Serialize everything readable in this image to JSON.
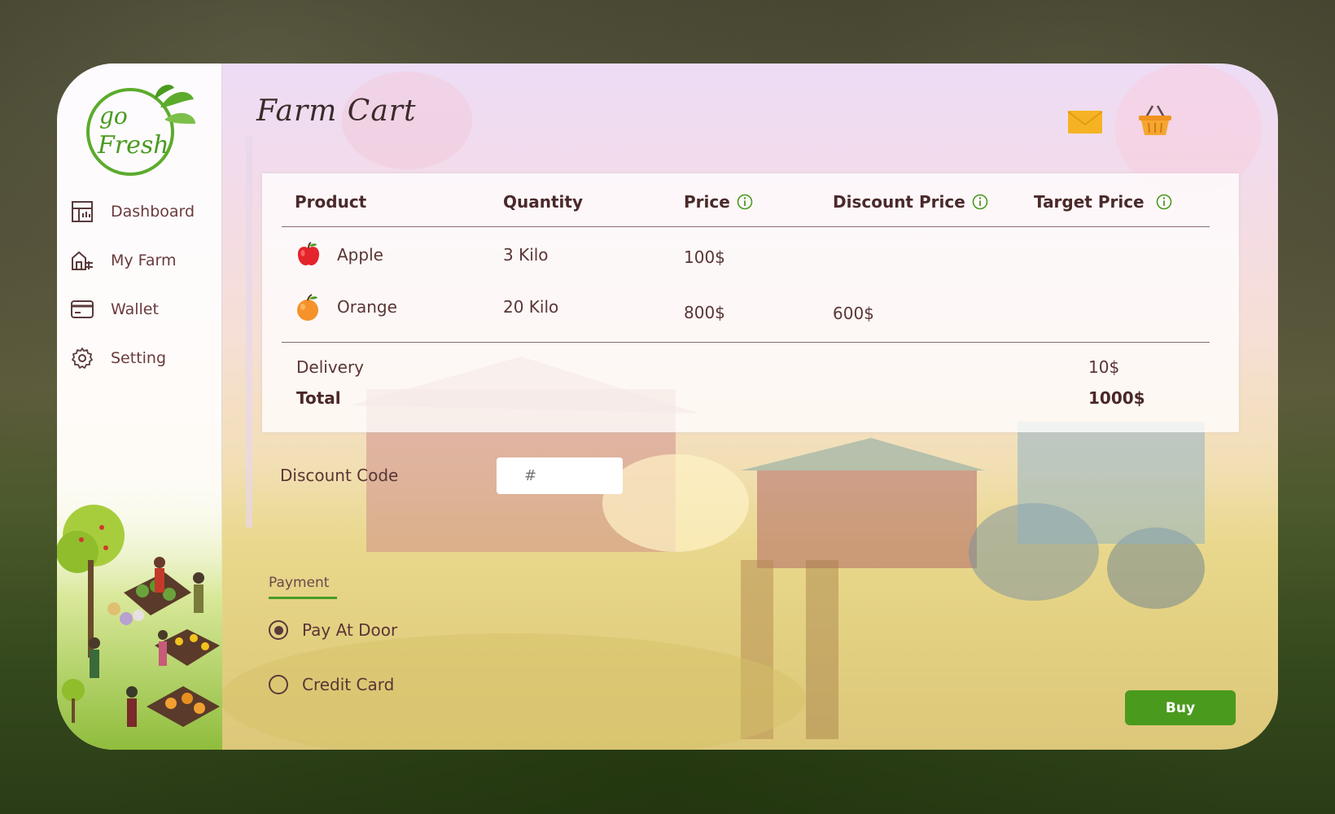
{
  "brand": {
    "logo_text_top": "go",
    "logo_text_bottom": "Fresh"
  },
  "sidebar": {
    "items": [
      {
        "label": "Dashboard",
        "icon": "dashboard-icon"
      },
      {
        "label": "My Farm",
        "icon": "farm-icon"
      },
      {
        "label": "Wallet",
        "icon": "wallet-icon"
      },
      {
        "label": "Setting",
        "icon": "gear-icon"
      }
    ]
  },
  "header": {
    "title": "Farm Cart",
    "icons": [
      "mail-icon",
      "basket-icon"
    ]
  },
  "cart": {
    "columns": [
      "Product",
      "Quantity",
      "Price",
      "Discount Price",
      "Target Price"
    ],
    "rows": [
      {
        "product": "Apple",
        "icon": "apple-icon",
        "quantity": "3 Kilo",
        "price": "100$",
        "discount_price": "",
        "target_price": ""
      },
      {
        "product": "Orange",
        "icon": "orange-icon",
        "quantity": "20 Kilo",
        "price": "800$",
        "discount_price": "600$",
        "target_price": ""
      }
    ],
    "delivery_label": "Delivery",
    "delivery_value": "10$",
    "total_label": "Total",
    "total_value": "1000$"
  },
  "discount": {
    "label": "Discount Code",
    "placeholder": "#"
  },
  "payment": {
    "label": "Payment",
    "options": [
      {
        "label": "Pay At Door",
        "selected": true
      },
      {
        "label": "Credit Card",
        "selected": false
      }
    ]
  },
  "actions": {
    "buy_label": "Buy"
  },
  "colors": {
    "accent_green": "#4a9a1e",
    "text_brown": "#5a3535",
    "mail_yellow": "#f5b324",
    "basket_orange": "#f0921e"
  }
}
